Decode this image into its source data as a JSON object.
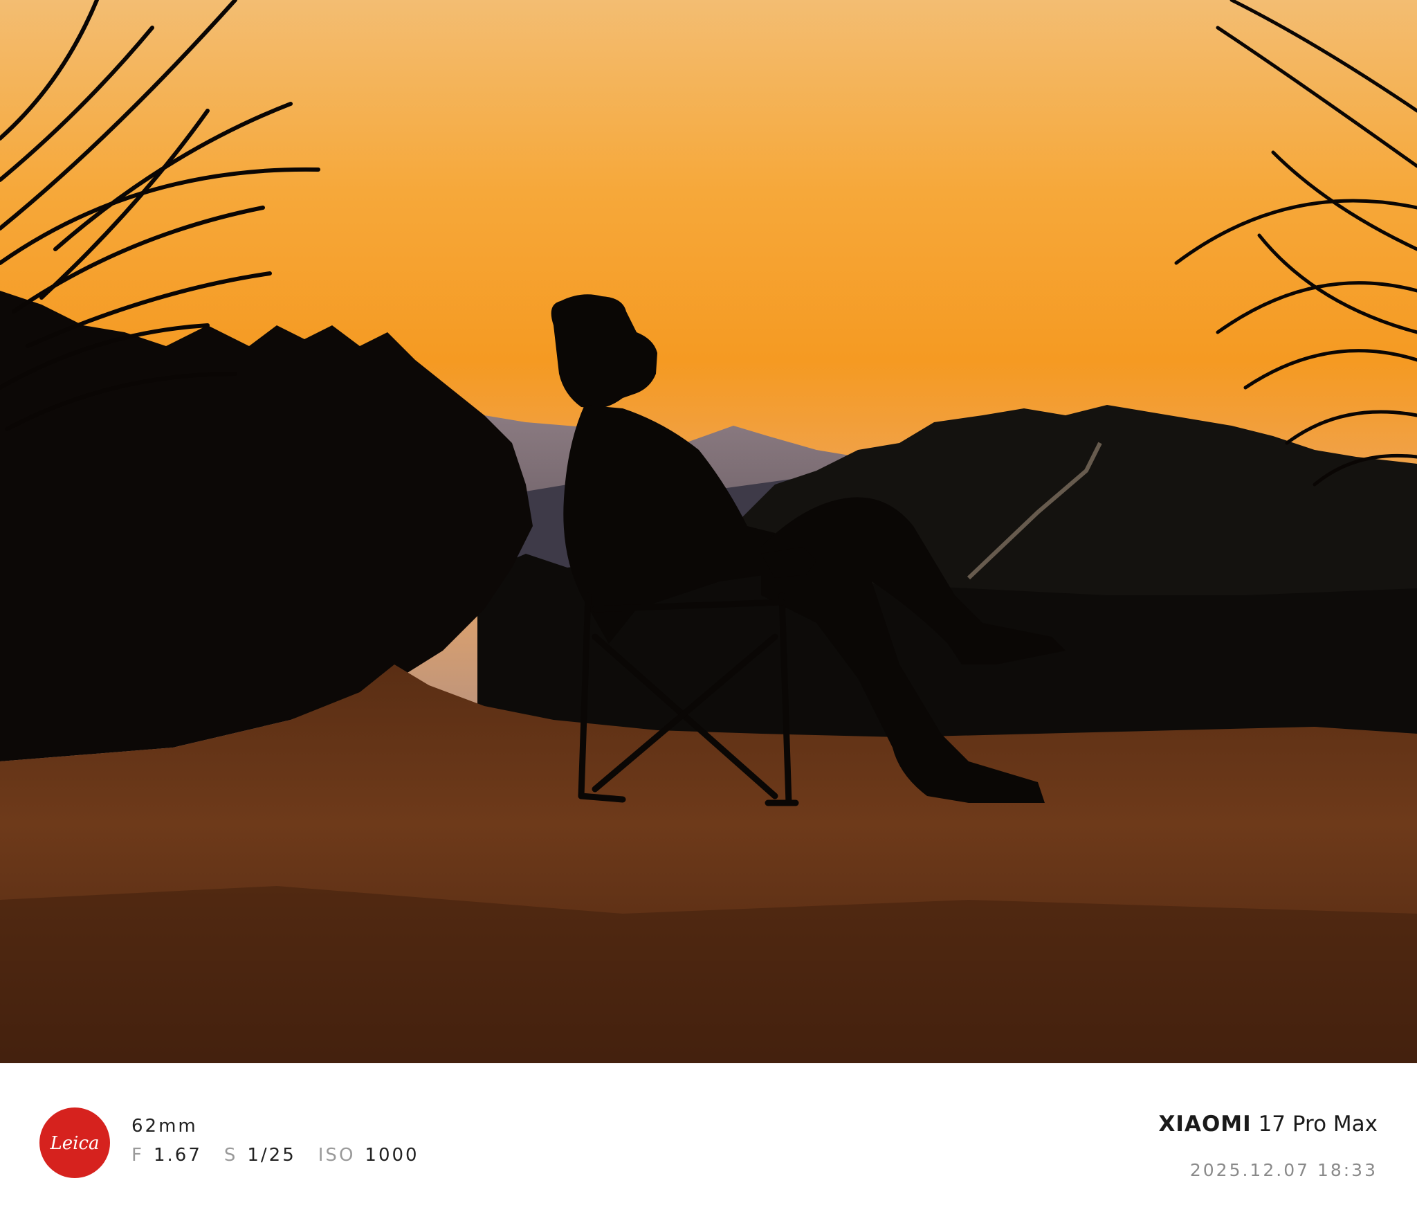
{
  "photo": {
    "subject": "silhouette-man-in-folding-chair-at-sunset",
    "colors": {
      "sky_top": "#f5b85a",
      "sky_mid": "#f59a22",
      "horizon": "#e8a04a",
      "ground": "#6b3a1c",
      "silhouette": "#0a0604"
    }
  },
  "watermark": {
    "logo_text": "Leica",
    "logo_color": "#d6221e",
    "focal_length": "62mm",
    "aperture_label": "F",
    "aperture_value": "1.67",
    "shutter_label": "S",
    "shutter_value": "1/25",
    "iso_label": "ISO",
    "iso_value": "1000",
    "brand": "XIAOMI",
    "model": "17 Pro Max",
    "datetime": "2025.12.07 18:33"
  }
}
